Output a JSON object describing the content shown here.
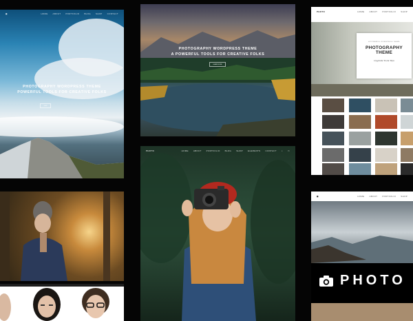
{
  "panel1": {
    "nav_items": [
      "HOME",
      "ABOUT",
      "PORTFOLIO",
      "BLOG",
      "SHOP",
      "CONTACT"
    ],
    "headline_1": "PHOTOGRAPHY WORDPRESS THEME",
    "headline_2": "POWERFUL TOOLS FOR CREATIVE FOLKS",
    "button": "VIEW"
  },
  "panel2": {
    "headline_1": "PHOTOGRAPHY WORDPRESS THEME",
    "headline_2": "A POWERFUL TOOLS FOR CREATIVE FOLKS",
    "button": "LEARN MORE"
  },
  "panel3": {
    "logo": "PHOTO",
    "nav_items": [
      "HOME",
      "ABOUT",
      "PORTFOLIO",
      "SHOP"
    ],
    "card_kicker": "A POWERFUL WORDPRESS THEME",
    "card_title": "PHOTOGRAPHY THEME",
    "card_signature": "Upgrade Tools Tips"
  },
  "panel6": {
    "logo": "PHOTO",
    "nav_items": [
      "HOME",
      "ABOUT",
      "PORTFOLIO",
      "BLOG",
      "SHOP",
      "ELEMENTS",
      "CONTACT"
    ]
  },
  "panel7": {
    "nav_items": [
      "HOME",
      "ABOUT",
      "PORTFOLIO",
      "SHOP"
    ],
    "brand_text": "PHOTO"
  }
}
